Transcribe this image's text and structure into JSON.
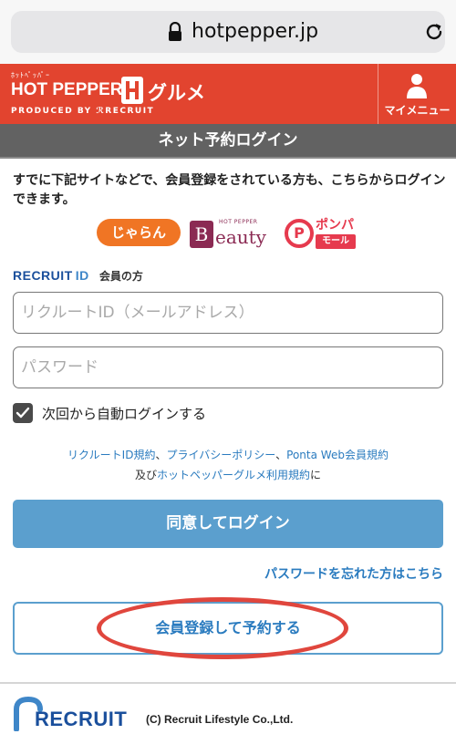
{
  "browser": {
    "url": "hotpepper.jp",
    "lock_icon": "lock-icon",
    "reload_icon": "reload-icon"
  },
  "header": {
    "logo_kana": "ﾎｯﾄﾍﾟｯﾊﾟｰ",
    "logo_main": "HOT PEPPER",
    "logo_sub": "グルメ",
    "produced_by": "PRODUCED BY ℛRECRUIT",
    "brand_color": "#e2442f",
    "mymenu_label": "マイメニュー",
    "mymenu_icon": "person-icon"
  },
  "title": "ネット予約ログイン",
  "intro": "すでに下記サイトなどで、会員登録をされている方も、こちらからログインできます。",
  "partners": {
    "jalan": "じゃらん",
    "beauty_small": "HOT PEPPER",
    "beauty_letter": "B",
    "beauty_text": "eauty",
    "ponpare_mark": "P",
    "ponpare_top": "ポンパレ",
    "ponpare_mall": "モール"
  },
  "recruit_id": {
    "logo": "RECRUIT",
    "logo_id": "ID",
    "label": "会員の方"
  },
  "form": {
    "loginid_placeholder": "リクルートID（メールアドレス）",
    "password_placeholder": "パスワード",
    "autologin_label": "次回から自動ログインする",
    "autologin_checked": true
  },
  "terms": {
    "link1": "リクルートID規約",
    "sep1": "、",
    "link2": "プライバシーポリシー",
    "sep2": "、",
    "link3": "Ponta Web会員規約",
    "prefix2": "及び",
    "link4": "ホットペッパーグルメ利用規約",
    "suffix2": "に"
  },
  "buttons": {
    "login": "同意してログイン",
    "forgot": "パスワードを忘れた方はこちら",
    "register": "会員登録して予約する"
  },
  "footer": {
    "logo": "RECRUIT",
    "copyright": "(C) Recruit Lifestyle Co.,Ltd."
  }
}
